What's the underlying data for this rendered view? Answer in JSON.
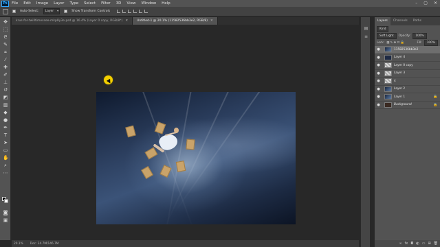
{
  "menubar": {
    "logo": "Ps",
    "items": [
      "File",
      "Edit",
      "Image",
      "Layer",
      "Type",
      "Select",
      "Filter",
      "3D",
      "View",
      "Window",
      "Help"
    ],
    "window_controls": [
      "–",
      "▢",
      "✕"
    ]
  },
  "options_bar": {
    "auto_select_label": "Auto-Select:",
    "auto_select_value": "Layer",
    "transform_label": "Show Transform Controls"
  },
  "doc_tabs": [
    {
      "label": "krus-for-twilltimessee-mkp8y3e.psd @ 16.4% (Layer 0 copy, RGB/8*)",
      "active": false
    },
    {
      "label": "Untitled-1 @ 20.1% (11582536bb3e2, RGB/8)",
      "active": true
    }
  ],
  "status": {
    "zoom": "20.1%",
    "doc_size": "Doc: 24.7M/146.7M"
  },
  "layers_panel": {
    "tabs": [
      "Layers",
      "Channels",
      "Paths"
    ],
    "filter_kind": "Kind",
    "blend_mode": "Soft Light",
    "opacity_label": "Opacity:",
    "opacity_value": "100%",
    "lock_label": "Lock:",
    "fill_label": "Fill:",
    "fill_value": "100%",
    "layers": [
      {
        "name": "11582536bb3e2",
        "thumb": "photo",
        "selected": true,
        "locked": false,
        "italic": false
      },
      {
        "name": "Layer 4",
        "thumb": "dark",
        "selected": false,
        "locked": false,
        "italic": false
      },
      {
        "name": "Layer 0 copy",
        "thumb": "checker",
        "selected": false,
        "locked": false,
        "italic": false
      },
      {
        "name": "Layer 3",
        "thumb": "checker",
        "selected": false,
        "locked": false,
        "italic": false
      },
      {
        "name": "4",
        "thumb": "checker",
        "selected": false,
        "locked": false,
        "italic": false
      },
      {
        "name": "Layer 2",
        "thumb": "photo",
        "selected": false,
        "locked": false,
        "italic": false
      },
      {
        "name": "Layer 1",
        "thumb": "photo",
        "selected": false,
        "locked": true,
        "italic": false
      },
      {
        "name": "Background",
        "thumb": "brown",
        "selected": false,
        "locked": true,
        "italic": true
      }
    ],
    "footer_icons": [
      "link-icon",
      "fx-icon",
      "mask-icon",
      "adjustment-icon",
      "folder-icon",
      "new-layer-icon",
      "trash-icon"
    ]
  },
  "colors": {
    "accent": "#31a8ff",
    "cursor_highlight": "#f4d000",
    "paper": "#c9a36a"
  }
}
